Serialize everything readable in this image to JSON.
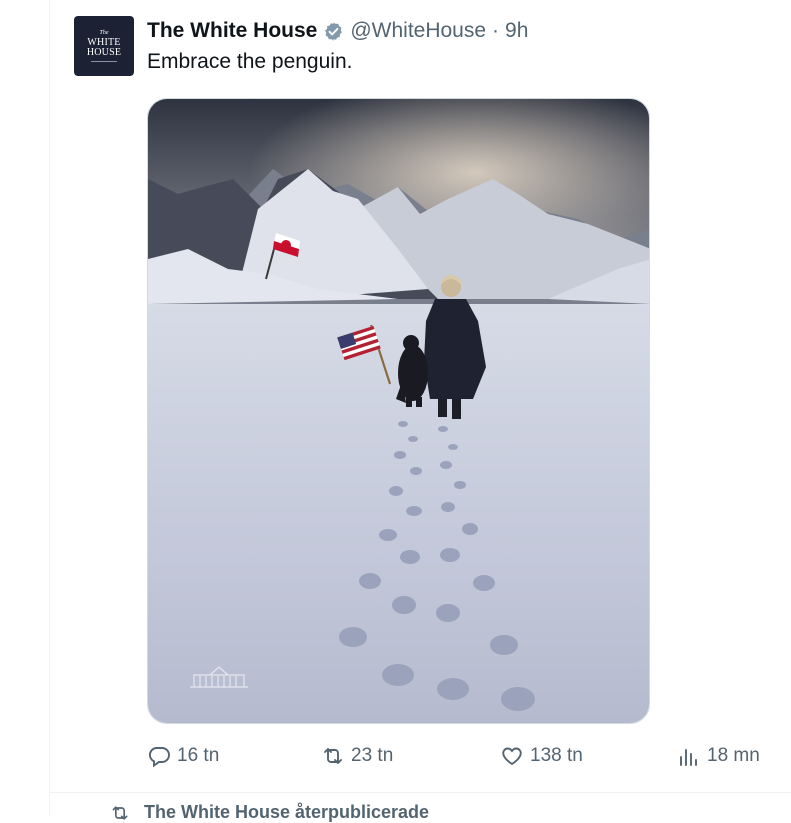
{
  "tweet": {
    "author_name": "The White House",
    "handle": "@WhiteHouse",
    "separator": "·",
    "time": "9h",
    "text": "Embrace the penguin.",
    "avatar": {
      "line1": "The",
      "line2": "WHITE",
      "line3": "HOUSE"
    },
    "verified_icon": "verified-badge-icon",
    "media_icon": "photo"
  },
  "actions": {
    "reply_count": "16 tn",
    "retweet_count": "23 tn",
    "like_count": "138 tn",
    "views_count": "18 mn"
  },
  "next_item": {
    "text": "The White House återpublicerade"
  },
  "colors": {
    "secondary_text": "#536471",
    "divider": "#eff3f4",
    "verified_badge": "#829aab"
  }
}
